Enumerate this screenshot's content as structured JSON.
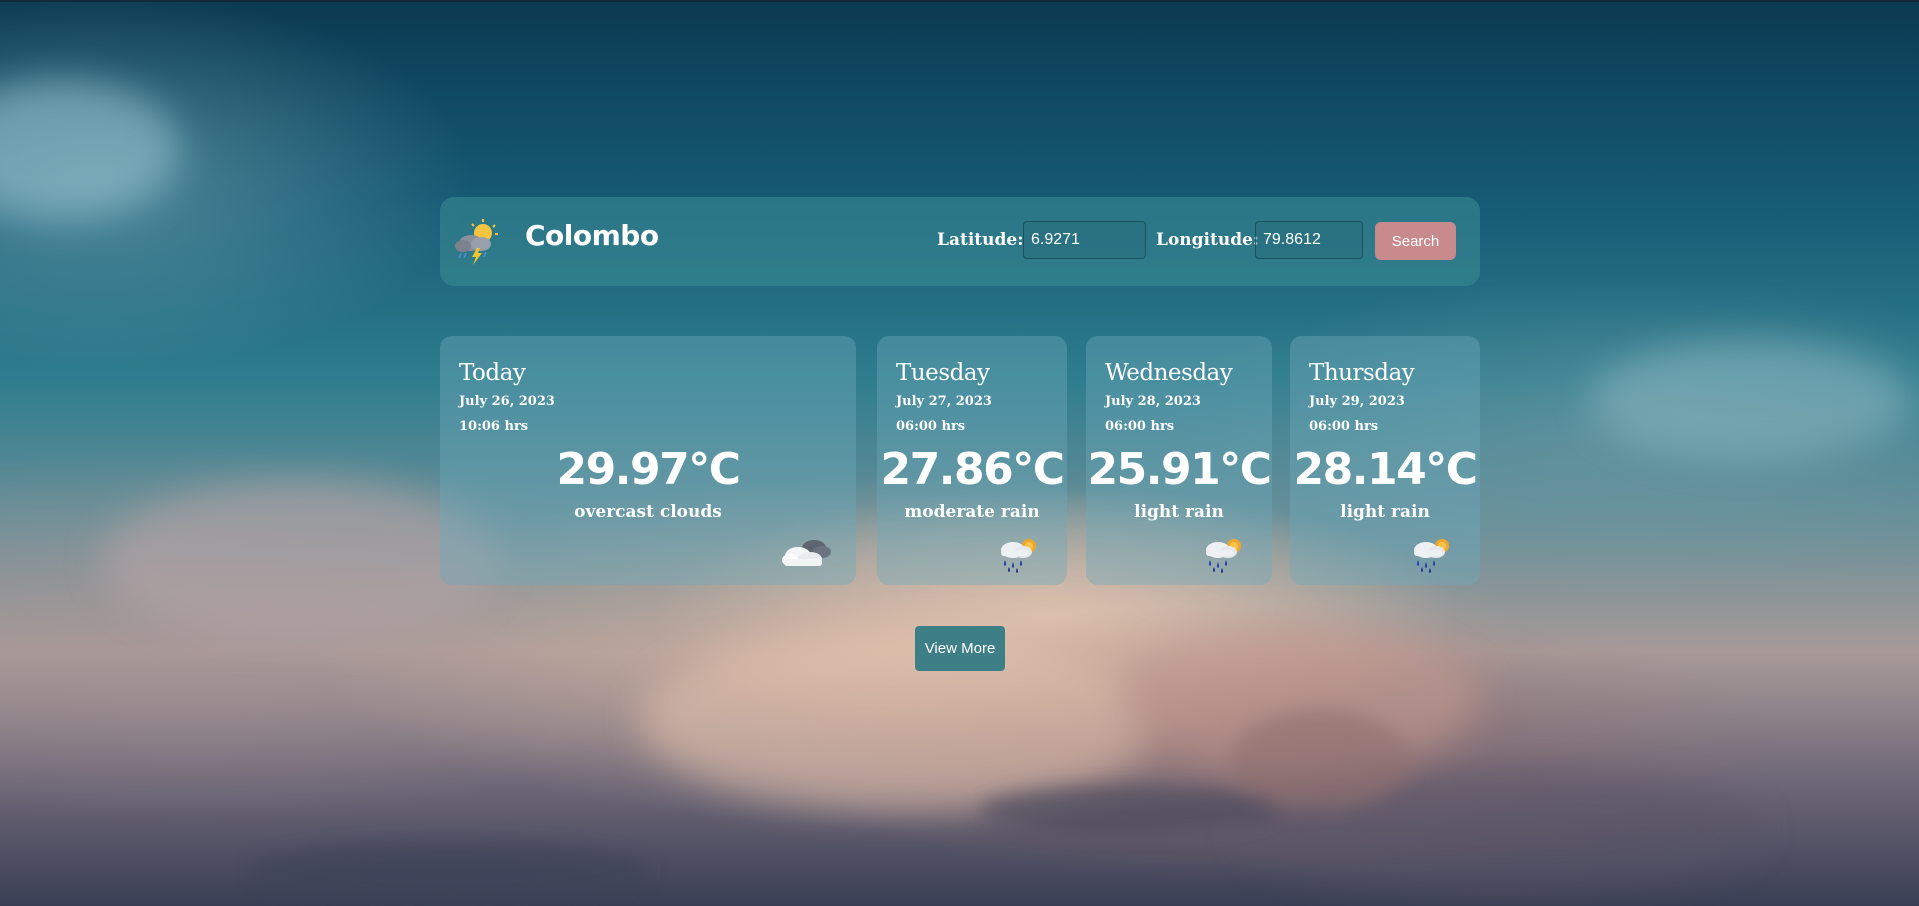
{
  "header": {
    "city": "Colombo",
    "latitude_label": "Latitude:",
    "latitude_value": "6.9271",
    "longitude_label": "Longitude:",
    "longitude_value": "79.8612",
    "search_label": "Search",
    "logo_icon": "sun-cloud-storm-icon"
  },
  "forecast": [
    {
      "day": "Today",
      "date": "July 26, 2023",
      "time": "10:06 hrs",
      "temp": "29.97°C",
      "desc": "overcast clouds",
      "icon": "overcast-clouds-icon"
    },
    {
      "day": "Tuesday",
      "date": "July 27, 2023",
      "time": "06:00 hrs",
      "temp": "27.86°C",
      "desc": "moderate rain",
      "icon": "rain-sun-icon"
    },
    {
      "day": "Wednesday",
      "date": "July 28, 2023",
      "time": "06:00 hrs",
      "temp": "25.91°C",
      "desc": "light rain",
      "icon": "rain-sun-icon"
    },
    {
      "day": "Thursday",
      "date": "July 29, 2023",
      "time": "06:00 hrs",
      "temp": "28.14°C",
      "desc": "light rain",
      "icon": "rain-sun-icon"
    }
  ],
  "view_more_label": "View More",
  "colors": {
    "search_button": "#c98a8e",
    "view_more_button": "#3d7e87"
  }
}
